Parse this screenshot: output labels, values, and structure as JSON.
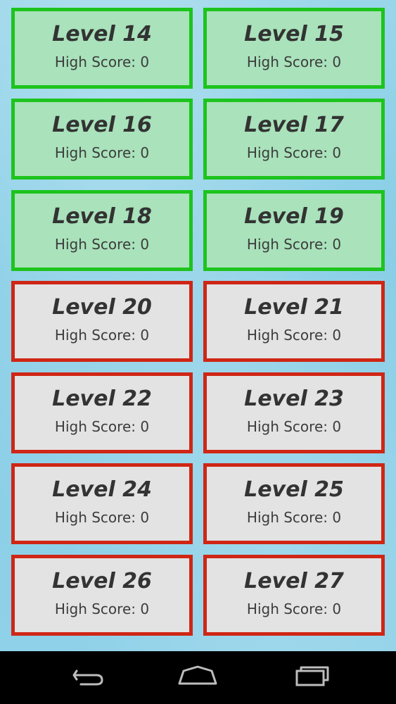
{
  "levels": [
    {
      "title": "Level 14",
      "score": "High Score: 0",
      "state": "unlocked"
    },
    {
      "title": "Level 15",
      "score": "High Score: 0",
      "state": "unlocked"
    },
    {
      "title": "Level 16",
      "score": "High Score: 0",
      "state": "unlocked"
    },
    {
      "title": "Level 17",
      "score": "High Score: 0",
      "state": "unlocked"
    },
    {
      "title": "Level 18",
      "score": "High Score: 0",
      "state": "unlocked"
    },
    {
      "title": "Level 19",
      "score": "High Score: 0",
      "state": "unlocked"
    },
    {
      "title": "Level 20",
      "score": "High Score: 0",
      "state": "locked"
    },
    {
      "title": "Level 21",
      "score": "High Score: 0",
      "state": "locked"
    },
    {
      "title": "Level 22",
      "score": "High Score: 0",
      "state": "locked"
    },
    {
      "title": "Level 23",
      "score": "High Score: 0",
      "state": "locked"
    },
    {
      "title": "Level 24",
      "score": "High Score: 0",
      "state": "locked"
    },
    {
      "title": "Level 25",
      "score": "High Score: 0",
      "state": "locked"
    },
    {
      "title": "Level 26",
      "score": "High Score: 0",
      "state": "locked"
    },
    {
      "title": "Level 27",
      "score": "High Score: 0",
      "state": "locked"
    }
  ],
  "colors": {
    "unlocked_border": "#1dc41d",
    "unlocked_fill": "#a9e2bb",
    "locked_border": "#cf2615",
    "locked_fill": "#e3e3e3",
    "background": "#8fd1e8",
    "navbar": "#000000"
  },
  "navbar": {
    "icons": [
      "back-icon",
      "home-icon",
      "recent-apps-icon"
    ]
  }
}
